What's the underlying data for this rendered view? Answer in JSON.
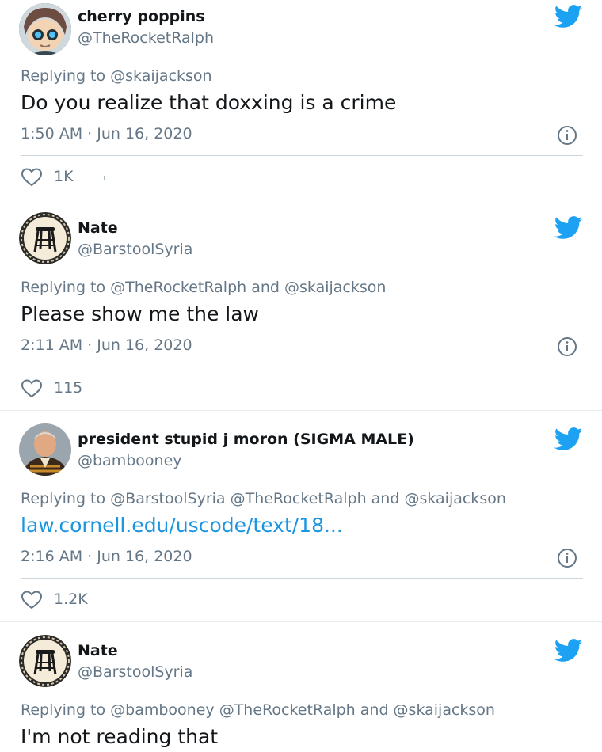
{
  "tweets": [
    {
      "name": "cherry poppins",
      "handle": "@TheRocketRalph",
      "replying": "Replying to @skaijackson",
      "text": "Do you realize that doxxing is a crime",
      "time": "1:50 AM · Jun 16, 2020",
      "likes": "1K",
      "avatar_icon": "cartoon-avatar-icon"
    },
    {
      "name": "Nate",
      "handle": "@BarstoolSyria",
      "replying": "Replying to @TheRocketRalph and @skaijackson",
      "text": "Please show me the law",
      "time": "2:11 AM · Jun 16, 2020",
      "likes": "115",
      "avatar_icon": "barstool-logo-icon"
    },
    {
      "name": "president stupid j moron (SIGMA MALE)",
      "handle": "@bambooney",
      "replying": "Replying to @BarstoolSyria @TheRocketRalph and @skaijackson",
      "text": "law.cornell.edu/uscode/text/18...",
      "time": "2:16 AM · Jun 16, 2020",
      "likes": "1.2K",
      "avatar_icon": "profile-photo-icon"
    },
    {
      "name": "Nate",
      "handle": "@BarstoolSyria",
      "replying": "Replying to @bambooney @TheRocketRalph and @skaijackson",
      "text": "I'm not reading that",
      "avatar_icon": "barstool-logo-icon"
    }
  ],
  "colors": {
    "twitter_blue": "#1da1f2",
    "link": "#1b95e0",
    "secondary_text": "#657786",
    "primary_text": "#14171a"
  }
}
